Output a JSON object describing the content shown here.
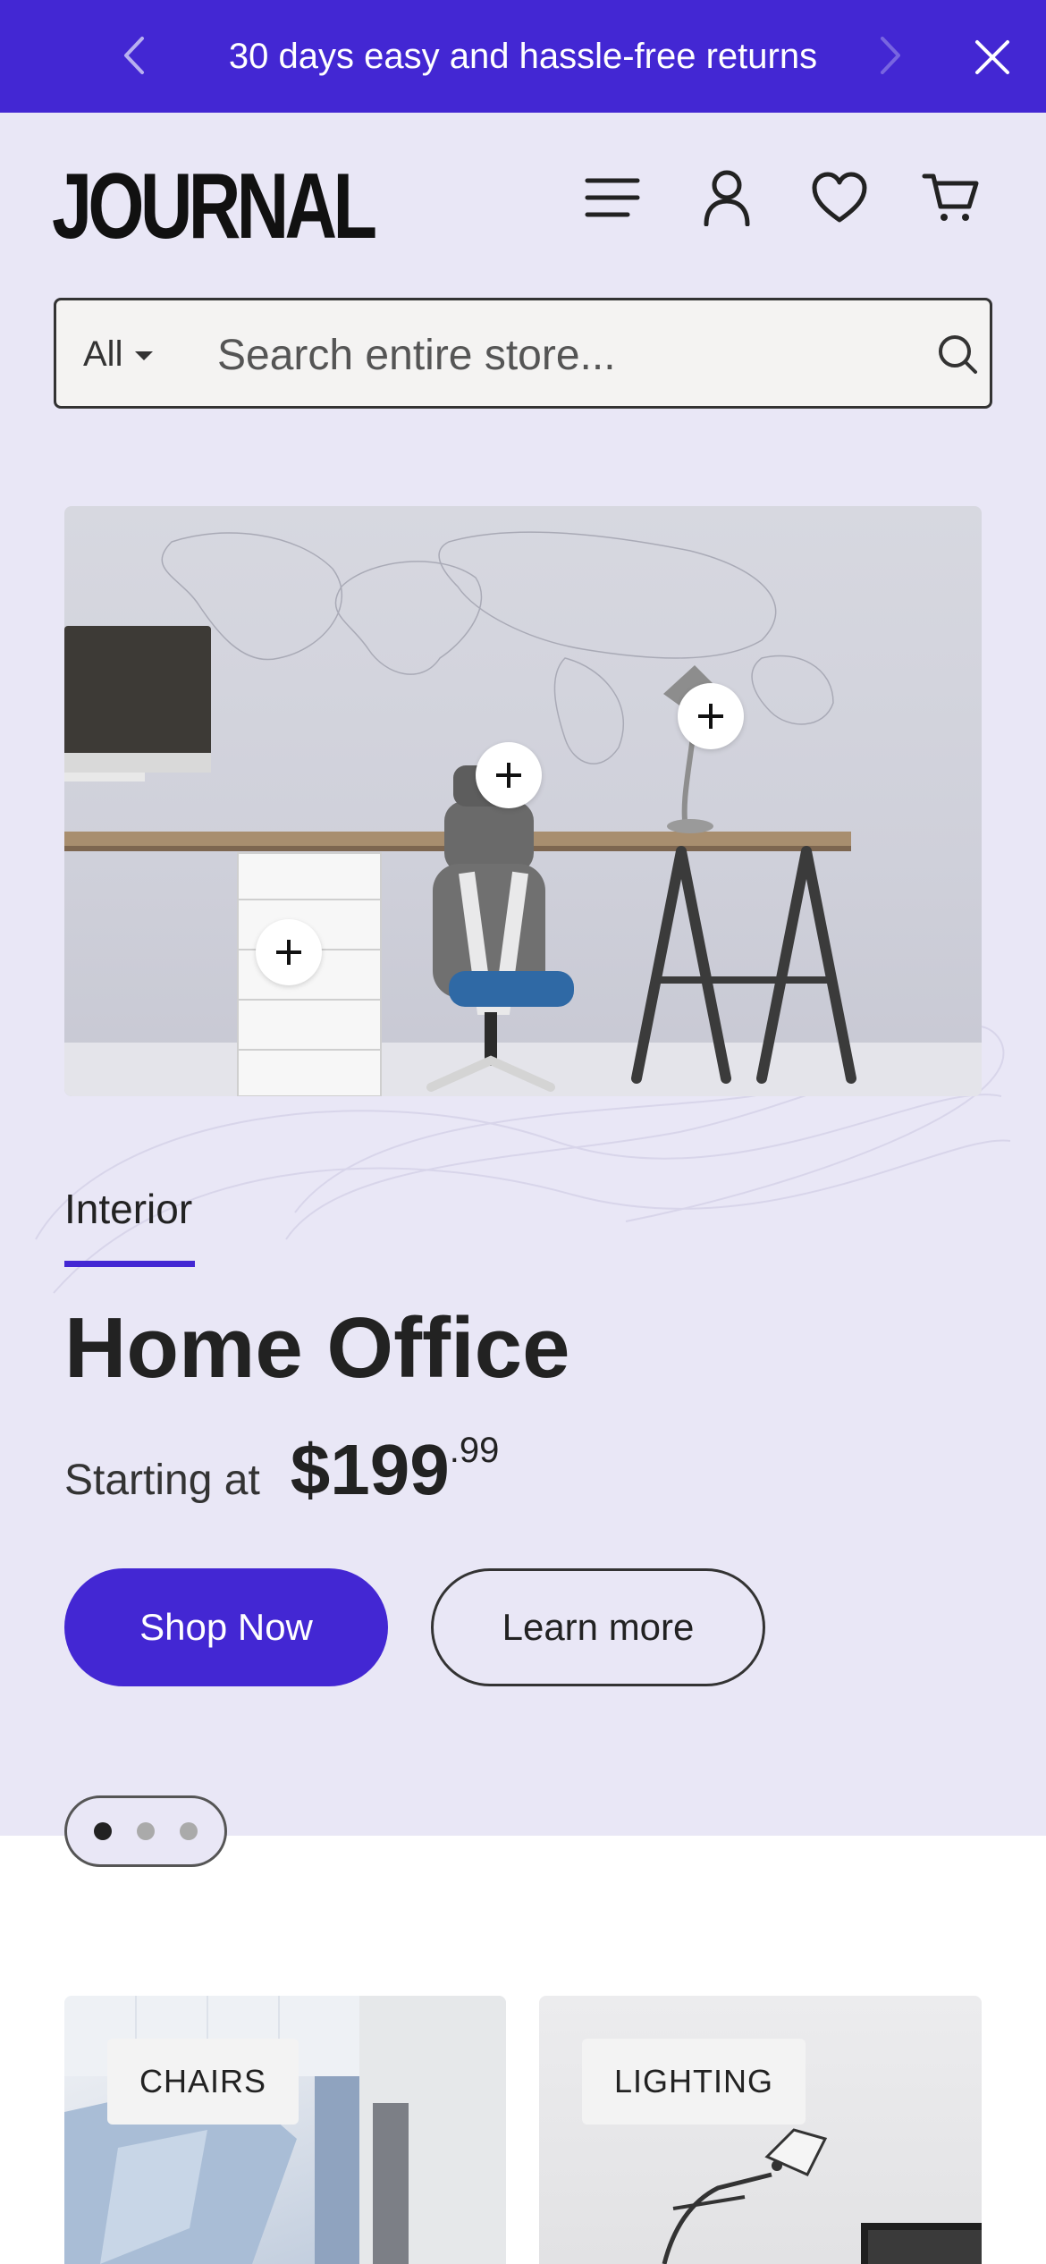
{
  "announcement": {
    "message": "30 days easy and hassle-free returns"
  },
  "header": {
    "logo_text": "JOURNAL"
  },
  "search": {
    "category": "All",
    "placeholder": "Search entire store..."
  },
  "hero": {
    "eyebrow": "Interior",
    "title": "Home Office",
    "price_prefix": "Starting at",
    "price_whole": "$199",
    "price_cents": ".99",
    "primary_button": "Shop Now",
    "secondary_button": "Learn more",
    "slides_total": 3,
    "active_slide": 1
  },
  "categories": [
    {
      "label": "CHAIRS"
    },
    {
      "label": "LIGHTING"
    }
  ],
  "colors": {
    "accent": "#4327d3",
    "hero_background": "#e9e7f6",
    "text": "#222222"
  }
}
